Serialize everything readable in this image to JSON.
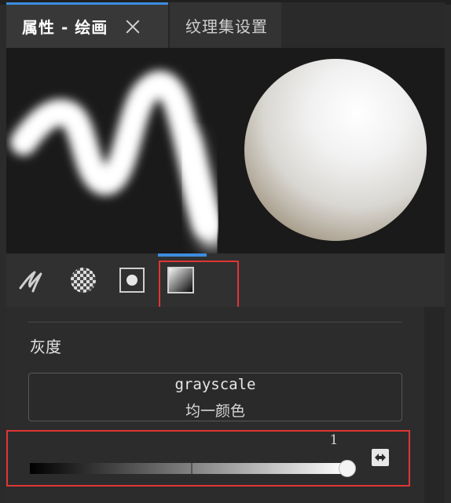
{
  "tabs": [
    {
      "label": "属性 - 绘画",
      "active": true,
      "close_icon": "close-icon"
    },
    {
      "label": "纹理集设置",
      "active": false
    }
  ],
  "preview": {
    "stroke": "brush-stroke-preview",
    "sphere": "material-sphere-preview"
  },
  "tools": [
    {
      "name": "brush",
      "icon": "brush-stroke-icon"
    },
    {
      "name": "alpha",
      "icon": "checker-alpha-icon"
    },
    {
      "name": "stencil",
      "icon": "stencil-dot-icon"
    },
    {
      "name": "material",
      "icon": "gradient-material-icon",
      "selected": true
    }
  ],
  "section": {
    "label": "灰度",
    "channel_name": "grayscale",
    "channel_mode": "均一颜色",
    "value": 1,
    "value_label": "1",
    "random_icon": "dice-random-icon"
  },
  "colors": {
    "accent": "#3d8de0",
    "highlight_box": "#e03535"
  }
}
